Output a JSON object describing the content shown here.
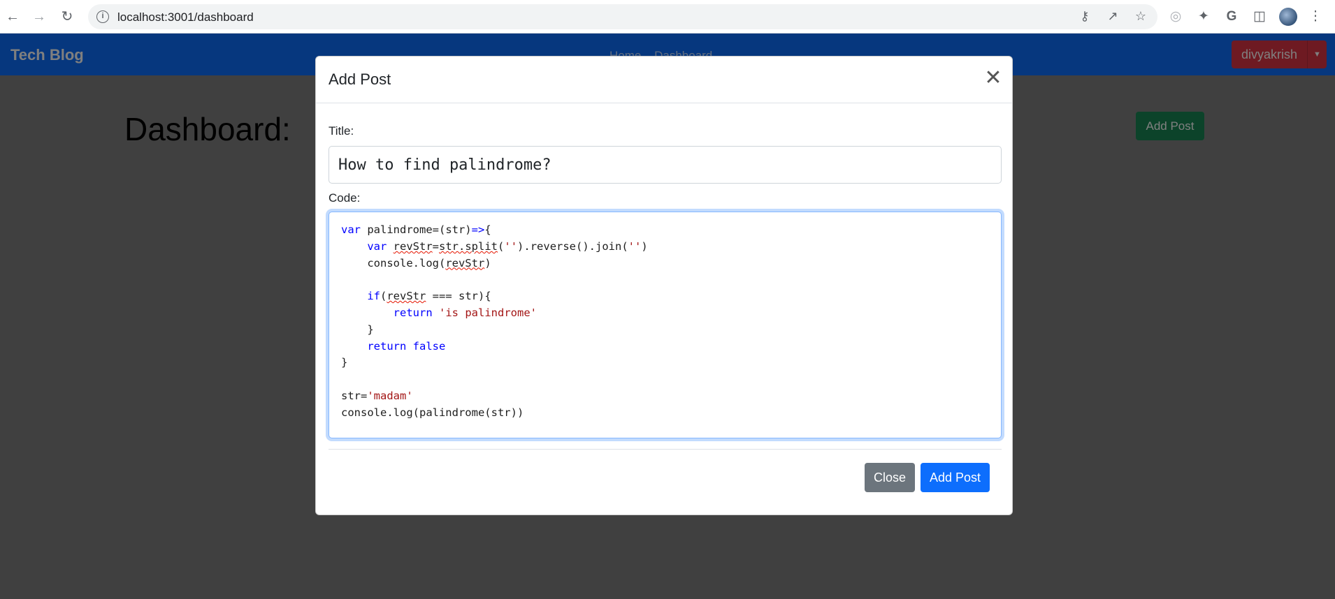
{
  "browser": {
    "url": "localhost:3001/dashboard",
    "back_icon": "arrow-left-icon",
    "forward_icon": "arrow-right-icon",
    "reload_icon": "reload-icon"
  },
  "navbar": {
    "brand": "Tech Blog",
    "links": [
      "Home",
      "Dashboard"
    ],
    "user": "divyakrish",
    "colors": {
      "primary": "#0d6efd",
      "user_button": "#dc3545"
    }
  },
  "page": {
    "title": "Dashboard:",
    "add_post_button": "Add Post"
  },
  "modal": {
    "title": "Add Post",
    "title_label": "Title:",
    "title_value": "How to find palindrome?",
    "code_label": "Code:",
    "code_lines": [
      "var palindrome=(str)=>{",
      "    var revStr=str.split('').reverse().join('')",
      "    console.log(revStr)",
      "",
      "    if(revStr === str){",
      "        return 'is palindrome'",
      "    }",
      "    return false",
      "}",
      "",
      "str='madam'",
      "console.log(palindrome(str))"
    ],
    "close_button": "Close",
    "submit_button": "Add Post"
  }
}
